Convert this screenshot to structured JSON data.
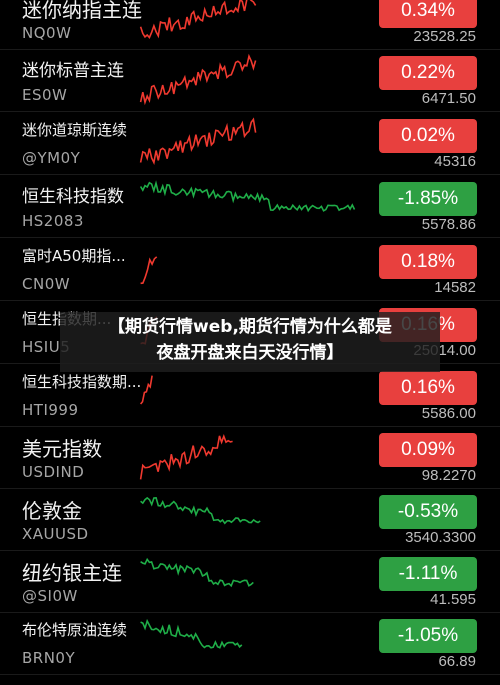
{
  "colors": {
    "up": "#e8403e",
    "down": "#2ea043",
    "line_up": "#f0392f",
    "line_down": "#1fae48"
  },
  "rows": [
    {
      "name": "迷你纳指主连",
      "code": "NQ0W",
      "change": "0.34%",
      "price": "23528.25",
      "dir": "up",
      "size": "lg"
    },
    {
      "name": "迷你标普主连",
      "code": "ES0W",
      "change": "0.22%",
      "price": "6471.50",
      "dir": "up",
      "size": "md"
    },
    {
      "name": "迷你道琼斯连续",
      "code": "@YM0Y",
      "change": "0.02%",
      "price": "45316",
      "dir": "up",
      "size": "sm"
    },
    {
      "name": "恒生科技指数",
      "code": "HS2083",
      "change": "-1.85%",
      "price": "5578.86",
      "dir": "down",
      "size": "md"
    },
    {
      "name": "富时A50期指...",
      "code": "CN0W",
      "change": "0.18%",
      "price": "14582",
      "dir": "up",
      "size": "sm"
    },
    {
      "name": "恒生指数期...",
      "code": "HSIU5",
      "change": "0.16%",
      "price": "25014.00",
      "dir": "up",
      "size": "sm"
    },
    {
      "name": "恒生科技指数期...",
      "code": "HTI999",
      "change": "0.16%",
      "price": "5586.00",
      "dir": "up",
      "size": "sm"
    },
    {
      "name": "美元指数",
      "code": "USDIND",
      "change": "0.09%",
      "price": "98.2270",
      "dir": "up",
      "size": "lg"
    },
    {
      "name": "伦敦金",
      "code": "XAUUSD",
      "change": "-0.53%",
      "price": "3540.3300",
      "dir": "down",
      "size": "lg"
    },
    {
      "name": "纽约银主连",
      "code": "@SI0W",
      "change": "-1.11%",
      "price": "41.595",
      "dir": "down",
      "size": "lg"
    },
    {
      "name": "布伦特原油连续",
      "code": "BRN0Y",
      "change": "-1.05%",
      "price": "66.89",
      "dir": "down",
      "size": "sm"
    }
  ],
  "overlay": {
    "line1": "【期货行情web,期货行情为什么都是",
    "line2": "夜盘开盘来白天没行情】"
  }
}
